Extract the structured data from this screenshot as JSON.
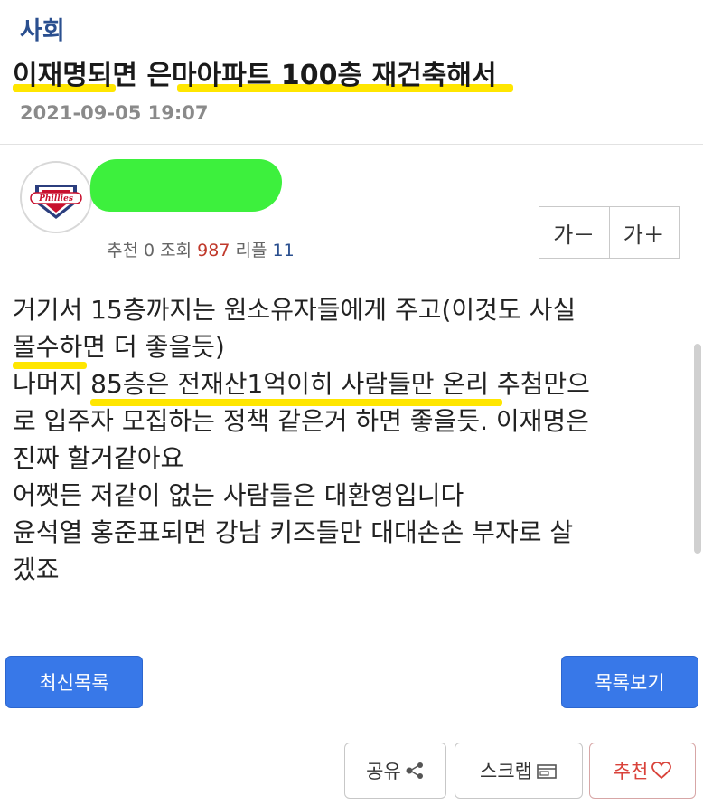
{
  "post": {
    "category": "사회",
    "title": "이재명되면 은마아파트 100층 재건축해서",
    "date": "2021-09-05 19:07"
  },
  "stats": {
    "recommend_label": "추천",
    "recommend_value": "0",
    "views_label": "조회",
    "views_value": "987",
    "replies_label": "리플",
    "replies_value": "11"
  },
  "font_controls": {
    "decrease": "가－",
    "increase": "가＋"
  },
  "avatar_logo_text": "Phillies",
  "body_lines": [
    "거기서 15층까지는 원소유자들에게 주고(이것도 사실",
    "몰수하면 더 좋을듯)",
    "나머지 85층은 전재산1억이히 사람들만 온리 추첨만으",
    "로 입주자 모집하는 정책 같은거 하면 좋을듯. 이재명은",
    "진짜 할거같아요",
    "어쨋든 저같이 없는 사람들은 대환영입니다",
    "윤석열 홍준표되면 강남 키즈들만 대대손손 부자로 살",
    "겠죠"
  ],
  "buttons": {
    "recent_list": "최신목록",
    "view_list": "목록보기",
    "share": "공유",
    "scrap": "스크랩",
    "recommend": "추천"
  },
  "colors": {
    "category": "#2a4f8f",
    "highlight": "#ffe600",
    "blue_button": "#3878e8",
    "recommend_red": "#d9423a"
  },
  "icons": {
    "share": "share-nodes-icon",
    "scrap": "window-icon",
    "recommend": "heart-icon"
  }
}
